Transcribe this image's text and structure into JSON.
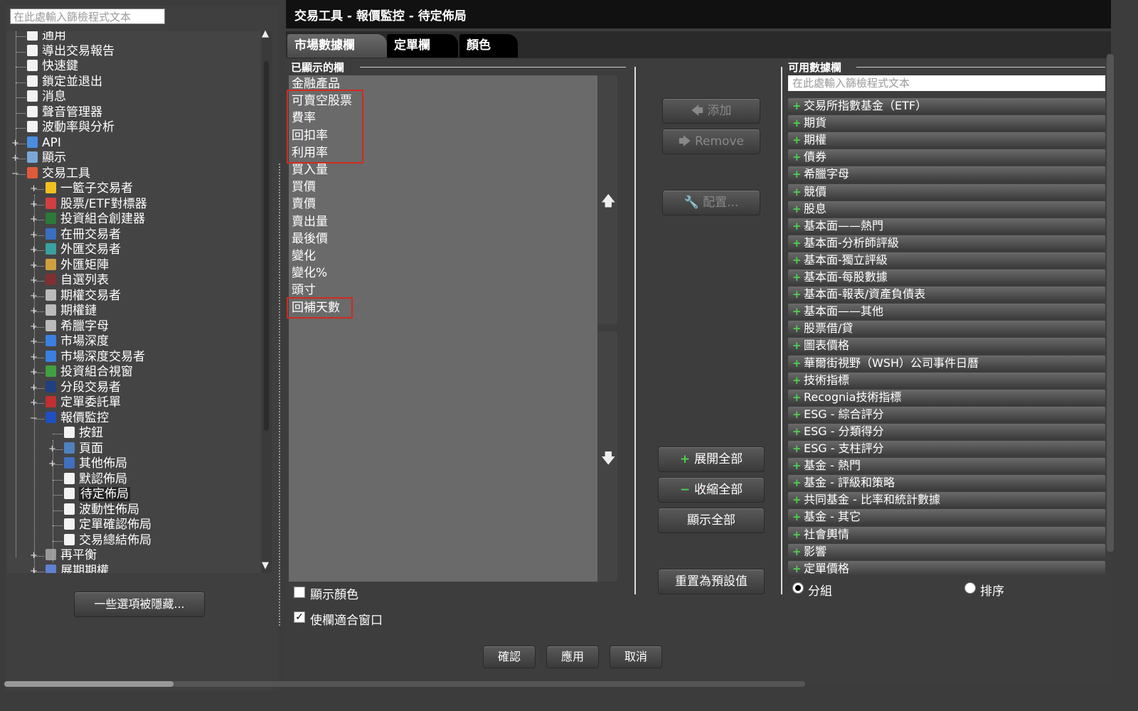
{
  "left": {
    "search_placeholder": "在此處輸入篩檢程式文本",
    "tree": [
      {
        "label": "通用",
        "level": 1,
        "icon": "doc"
      },
      {
        "label": "導出交易報告",
        "level": 1,
        "icon": "doc"
      },
      {
        "label": "快速鍵",
        "level": 1,
        "icon": "doc"
      },
      {
        "label": "鎖定並退出",
        "level": 1,
        "icon": "doc"
      },
      {
        "label": "消息",
        "level": 1,
        "icon": "doc"
      },
      {
        "label": "聲音管理器",
        "level": 1,
        "icon": "doc"
      },
      {
        "label": "波動率與分析",
        "level": 1,
        "icon": "doc"
      },
      {
        "label": "API",
        "level": 1,
        "icon": "api-icon"
      },
      {
        "label": "顯示",
        "level": 1,
        "icon": "display-icon"
      },
      {
        "label": "交易工具",
        "level": 1,
        "icon": "tools-icon"
      },
      {
        "label": "一籃子交易者",
        "level": 2,
        "icon": "basket-icon"
      },
      {
        "label": "股票/ETF對標器",
        "level": 2,
        "icon": "bar-chart-icon"
      },
      {
        "label": "投資組合創建器",
        "level": 2,
        "icon": "portfolio-icon"
      },
      {
        "label": "在冊交易者",
        "level": 2,
        "icon": "book-icon"
      },
      {
        "label": "外匯交易者",
        "level": 2,
        "icon": "fx-icon"
      },
      {
        "label": "外匯矩陣",
        "level": 2,
        "icon": "fx-matrix-icon"
      },
      {
        "label": "自選列表",
        "level": 2,
        "icon": "watchlist-icon"
      },
      {
        "label": "期權交易者",
        "level": 2,
        "icon": "option-icon"
      },
      {
        "label": "期權鏈",
        "level": 2,
        "icon": "option-chain-icon"
      },
      {
        "label": "希臘字母",
        "level": 2,
        "icon": "greeks-icon"
      },
      {
        "label": "市場深度",
        "level": 2,
        "icon": "depth-icon"
      },
      {
        "label": "市場深度交易者",
        "level": 2,
        "icon": "depth-trader-icon"
      },
      {
        "label": "投資組合視窗",
        "level": 2,
        "icon": "portfolio-window-icon"
      },
      {
        "label": "分段交易者",
        "level": 2,
        "icon": "split-icon"
      },
      {
        "label": "定單委託單",
        "level": 2,
        "icon": "order-ticket-icon"
      },
      {
        "label": "報價監控",
        "level": 2,
        "icon": "ib-icon"
      },
      {
        "label": "按鈕",
        "level": 3,
        "icon": "doc"
      },
      {
        "label": "頁面",
        "level": 3,
        "icon": "page-icon"
      },
      {
        "label": "其他佈局",
        "level": 3,
        "icon": "layout-icon"
      },
      {
        "label": "默認佈局",
        "level": 3,
        "icon": "doc"
      },
      {
        "label": "待定佈局",
        "level": 3,
        "icon": "doc",
        "selected": true
      },
      {
        "label": "波動性佈局",
        "level": 3,
        "icon": "doc"
      },
      {
        "label": "定單確認佈局",
        "level": 3,
        "icon": "doc"
      },
      {
        "label": "交易總結佈局",
        "level": 3,
        "icon": "doc"
      },
      {
        "label": "再平衡",
        "level": 2,
        "icon": "rebalance-icon"
      },
      {
        "label": "展期期權",
        "level": 2,
        "icon": "rollover-icon"
      }
    ],
    "hidden_button": "一些選項被隱藏..."
  },
  "window": {
    "title": "交易工具 - 報價監控 - 待定佈局"
  },
  "tabs": [
    "市場數據欄",
    "定單欄",
    "顏色"
  ],
  "shown": {
    "heading": "已顯示的欄",
    "items": [
      "金融產品",
      "可賣空股票",
      "費率",
      "回扣率",
      "利用率",
      "買入量",
      "買價",
      "賣價",
      "賣出量",
      "最後價",
      "變化",
      "變化%",
      "頭寸",
      "回補天數"
    ]
  },
  "options": {
    "show_color": "顯示顏色",
    "fit_window": "使欄適合窗口",
    "show_color_checked": false,
    "fit_window_checked": true
  },
  "middle": {
    "add": "添加",
    "remove": "Remove",
    "configure": "配置...",
    "expand_all": "展開全部",
    "collapse_all": "收縮全部",
    "show_all": "顯示全部",
    "reset": "重置為預設值"
  },
  "available": {
    "heading": "可用數據欄",
    "search_placeholder": "在此處輸入篩檢程式文本",
    "items": [
      "交易所指數基金（ETF）",
      "期貨",
      "期權",
      "債券",
      "希臘字母",
      "競價",
      "股息",
      "基本面——熱門",
      "基本面-分析師評級",
      "基本面-獨立評級",
      "基本面-每股數據",
      "基本面-報表/資產負債表",
      "基本面——其他",
      "股票借/貸",
      "圖表價格",
      "華爾街視野（WSH）公司事件日曆",
      "技術指標",
      "Recognia技術指標",
      "ESG - 綜合評分",
      "ESG - 分類得分",
      "ESG - 支柱評分",
      "基金 - 熱門",
      "基金 - 評級和策略",
      "共同基金 - 比率和統計數據",
      "基金 - 其它",
      "社會輿情",
      "影響",
      "定單價格"
    ],
    "group_label": "分組",
    "sort_label": "排序"
  },
  "footer": {
    "ok": "確認",
    "apply": "應用",
    "cancel": "取消"
  }
}
